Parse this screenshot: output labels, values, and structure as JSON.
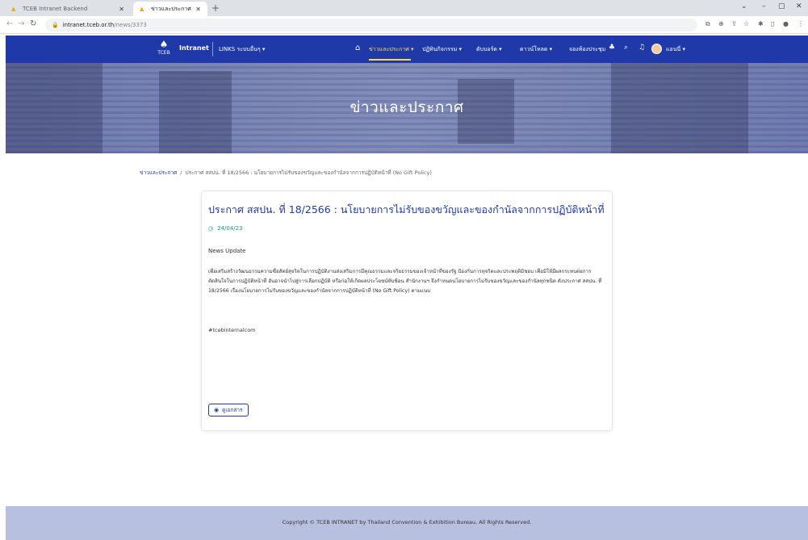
{
  "browser": {
    "tabs": [
      {
        "title": "TCEB Intranet Backend"
      },
      {
        "title": "ข่าวและประกาศ"
      }
    ],
    "new_tab": "+",
    "url_host": "intranet.tceb.or.th",
    "url_path": "/news/3373",
    "window_controls": {
      "minimize": "–",
      "maximize": "▢",
      "close": "✕"
    }
  },
  "nav": {
    "logo_text": "TCEB",
    "brand": "Intranet",
    "links_label": "LINKS ระบบอื่นๆ ▾",
    "items": [
      {
        "label": "ข่าวและประกาศ ▾",
        "active": true
      },
      {
        "label": "ปฏิทินกิจกรรม ▾"
      },
      {
        "label": "ดับบอร์ด ▾"
      },
      {
        "label": "ดาวน์โหลด ▾"
      },
      {
        "label": "จองห้องประชุม"
      }
    ],
    "user_label": "แอนนี่ ▾",
    "icons": [
      "home-icon",
      "people-icon",
      "search-icon",
      "bell-icon"
    ]
  },
  "hero": {
    "title": "ข่าวและประกาศ"
  },
  "breadcrumb": {
    "root": "ข่าวและประกาศ",
    "separator": "/",
    "current": "ประกาศ สสปน. ที่ 18/2566 : นโยบายการไม่รับของขวัญและของกำนัลจากการปฏิบัติหน้าที่ (No Gift Policy)"
  },
  "article": {
    "title": "ประกาศ สสปน. ที่ 18/2566 : นโยบายการไม่รับของขวัญและของกำนัลจากการปฏิบัติหน้าที่ (No Gift Policy)",
    "date": "24/04/23",
    "label": "News Update",
    "body": "เพื่อเสริมสร้างวัฒนธรรมความซื่อสัตย์สุจริตในการปฏิบัติงานส่งเสริมการมีคุณธรรมและจริยธรรมของเจ้าหน้าที่ของรัฐ ป้องกันการทุจริตและประพฤติมิชอบ เพื่อมิให้มีผลกระทบต่อการตัดสินใจในการปฏิบัติหน้าที่ อันอาจนำไปสู่การเลือกปฏิบัติ หรือก่อให้เกิดผลประโยชน์ทับซ้อน สำนักงานฯ จึงกำหนดนโยบายการไม่รับของขวัญและของกำนัลทุกชนิด ดังประกาศ สสปน. ที่ 18/2566 เรื่องนโยบายการไม่รับของขวัญและของกำนัลจากการปฏิบัติหน้าที่ (No Gift Policy) ตามแนบ",
    "tag": "#tcebinternalcom",
    "detail_button": "ดูเอกสาร"
  },
  "footer": {
    "text": "Copyright © TCEB INTRANET by Thailand Convention & Exhibition Bureau. All Rights Reserved."
  },
  "colors": {
    "nav": "#1f3aa8",
    "accent": "#ffd54a",
    "date": "#1aa37a",
    "footer": "#b7c0de"
  }
}
